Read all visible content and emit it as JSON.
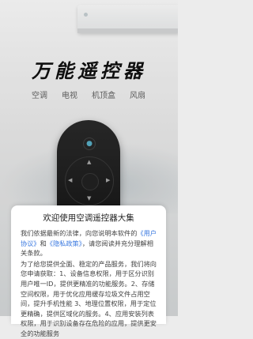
{
  "header": {
    "title": "万能遥控器"
  },
  "categories": [
    {
      "label": "空调"
    },
    {
      "label": "电视"
    },
    {
      "label": "机顶盒"
    },
    {
      "label": "风扇"
    }
  ],
  "dialog": {
    "title": "欢迎使用空调遥控器大集",
    "p1_before": "我们依据最新的法律，向您说明本软件的",
    "link_user": "《用户协议》",
    "p1_and": "和",
    "link_privacy": "《隐私政策》",
    "p1_after": "，请您阅读并充分理解相关条款。",
    "p2": "为了给您提供全面、稳定的产品服务，我们将向您申请获取：1、设备信息权限，用于区分识别用户唯一ID，提供更精准的功能服务。2、存储空间权限，用于优化应用缓存垃圾文件占用空间，提升手机性能 3、地理位置权限，用于定位更精确，提供区域化的服务。4、应用安装列表权限，用于识别设备存在危险的应用，提供更安全的功能服务"
  },
  "colors": {
    "link": "#3a79e0",
    "accent": "#5ab0c8"
  },
  "icons": {
    "remote_mic": "mic-icon"
  }
}
